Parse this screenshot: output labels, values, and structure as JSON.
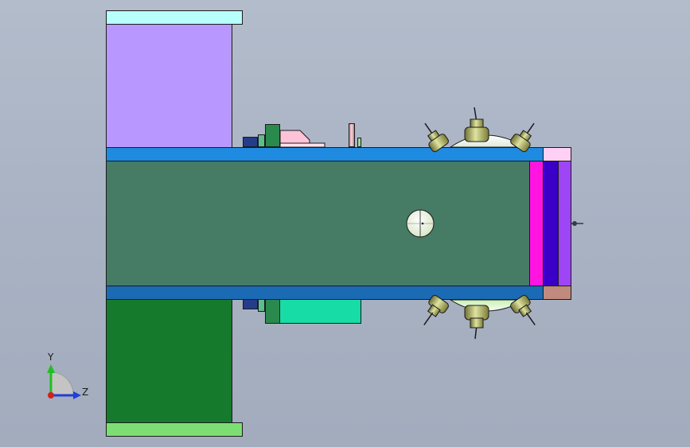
{
  "scene": {
    "name": "cad-3d-model-viewport",
    "colors": {
      "background_top": "#b3bccb",
      "background_bottom": "#a2acbd",
      "top_cap": "#b6fffb",
      "top_block": "#b898ff",
      "upper_rail": "#1e8be0",
      "main_body": "#467b66",
      "lower_rail": "#1b6ab4",
      "bottom_block": "#157a2c",
      "bottom_cap": "#7ddf73",
      "magenta_band": "#ff14e1",
      "indigo_band": "#3a00c8",
      "violet_band": "#9e46f6",
      "pink_cap": "#ffd0f5",
      "brown_cap": "#c08a7e",
      "teal_block": "#17dca6",
      "pink_wedge": "#ffc3d8",
      "bracket_green": "#2a8a4e",
      "bracket_navy": "#243c8a",
      "sensor_olive": "#b7bb66"
    },
    "icons": [
      "coordinate-triad-icon",
      "sensor-probe-icon",
      "knob-icon"
    ]
  },
  "triad": {
    "y_label": "Y",
    "z_label": "Z",
    "y_color": "#1fbf1f",
    "z_color": "#1f3fd6",
    "x_color": "#d61f1f"
  }
}
